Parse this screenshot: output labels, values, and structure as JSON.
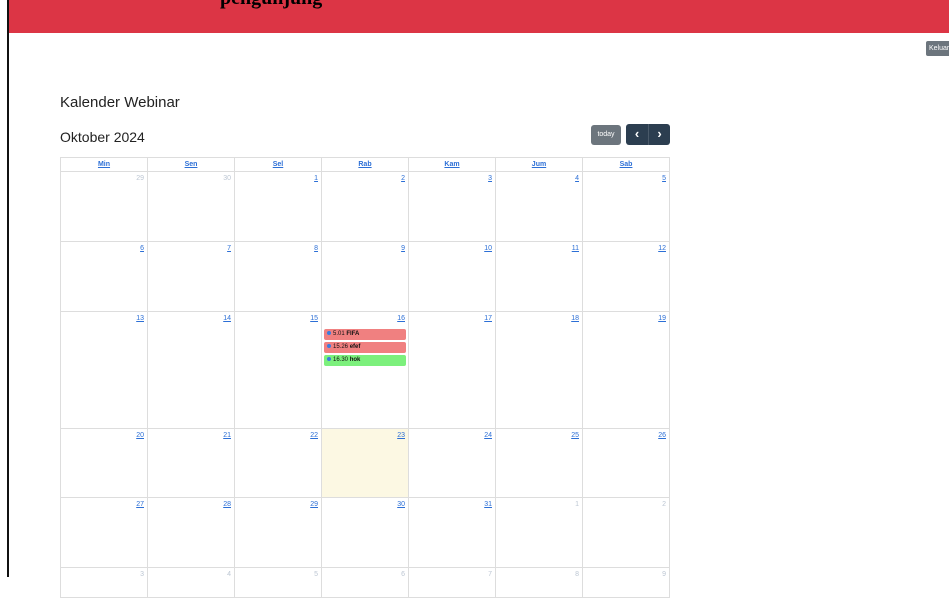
{
  "header": {
    "cut_title": "pengunjung"
  },
  "logout_label": "Keluar",
  "page_title": "Kalender Webinar",
  "calendar": {
    "month_title": "Oktober 2024",
    "today_label": "today",
    "prev_label": "‹",
    "next_label": "›",
    "day_names": [
      "Min",
      "Sen",
      "Sel",
      "Rab",
      "Kam",
      "Jum",
      "Sab"
    ],
    "weeks": [
      [
        {
          "n": "29",
          "other": true
        },
        {
          "n": "30",
          "other": true
        },
        {
          "n": "1"
        },
        {
          "n": "2"
        },
        {
          "n": "3"
        },
        {
          "n": "4"
        },
        {
          "n": "5"
        }
      ],
      [
        {
          "n": "6"
        },
        {
          "n": "7"
        },
        {
          "n": "8"
        },
        {
          "n": "9"
        },
        {
          "n": "10"
        },
        {
          "n": "11"
        },
        {
          "n": "12"
        }
      ],
      [
        {
          "n": "13"
        },
        {
          "n": "14"
        },
        {
          "n": "15"
        },
        {
          "n": "16",
          "events": [
            {
              "time": "5.01",
              "title": "FIFA",
              "color": "#f08080"
            },
            {
              "time": "15.26",
              "title": "efef",
              "color": "#f08080"
            },
            {
              "time": "16.30",
              "title": "hok",
              "color": "#7cf07c"
            }
          ]
        },
        {
          "n": "17"
        },
        {
          "n": "18"
        },
        {
          "n": "19"
        }
      ],
      [
        {
          "n": "20"
        },
        {
          "n": "21"
        },
        {
          "n": "22"
        },
        {
          "n": "23",
          "today": true
        },
        {
          "n": "24"
        },
        {
          "n": "25"
        },
        {
          "n": "26"
        }
      ],
      [
        {
          "n": "27"
        },
        {
          "n": "28"
        },
        {
          "n": "29"
        },
        {
          "n": "30"
        },
        {
          "n": "31"
        },
        {
          "n": "1",
          "other": true
        },
        {
          "n": "2",
          "other": true
        }
      ],
      [
        {
          "n": "3",
          "other": true
        },
        {
          "n": "4",
          "other": true
        },
        {
          "n": "5",
          "other": true
        },
        {
          "n": "6",
          "other": true
        },
        {
          "n": "7",
          "other": true
        },
        {
          "n": "8",
          "other": true
        },
        {
          "n": "9",
          "other": true
        }
      ]
    ]
  }
}
